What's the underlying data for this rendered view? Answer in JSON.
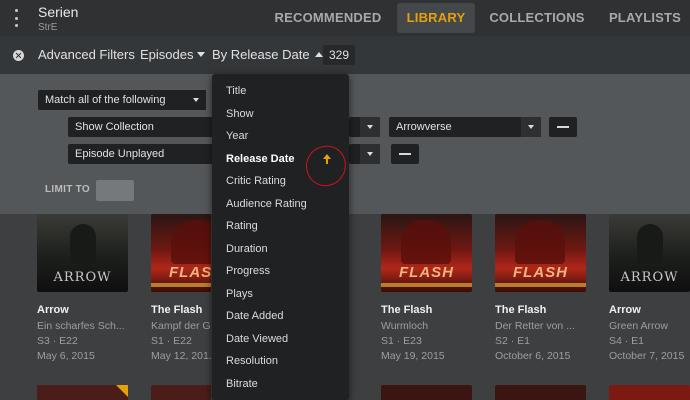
{
  "header": {
    "library_title": "Serien",
    "library_subtitle": "StrE",
    "tabs": [
      {
        "label": "RECOMMENDED"
      },
      {
        "label": "LIBRARY"
      },
      {
        "label": "COLLECTIONS"
      },
      {
        "label": "PLAYLISTS"
      }
    ],
    "active_tab": "LIBRARY",
    "accent_color": "#e5a00d"
  },
  "filter_bar": {
    "advanced_filters_label": "Advanced Filters",
    "type_label": "Episodes",
    "sort_label": "By Release Date",
    "count": "329"
  },
  "advanced_panel": {
    "match_label": "Match all of the following",
    "rules": [
      {
        "field": "Show Collection",
        "value": "Arrowverse"
      },
      {
        "field": "Episode Unplayed"
      }
    ],
    "limit_label": "LIMIT TO"
  },
  "sort_menu": {
    "items": [
      "Title",
      "Show",
      "Year",
      "Release Date",
      "Critic Rating",
      "Audience Rating",
      "Rating",
      "Duration",
      "Progress",
      "Plays",
      "Date Added",
      "Date Viewed",
      "Resolution",
      "Bitrate"
    ],
    "selected": "Release Date",
    "annotation_color": "#d3101f"
  },
  "episodes": [
    {
      "show": "Arrow",
      "episode_title": "Ein scharfes Sch...",
      "code": "S3 · E22",
      "date": "May 6, 2015",
      "poster": "arrow"
    },
    {
      "show": "The Flash",
      "episode_title": "Kampf der G...",
      "code": "S1 · E22",
      "date": "May 12, 201...",
      "poster": "flash"
    },
    {
      "show": "The Flash",
      "episode_title": "Wurmloch",
      "code": "S1 · E23",
      "date": "May 19, 2015",
      "poster": "flash"
    },
    {
      "show": "The Flash",
      "episode_title": "Der Retter von ...",
      "code": "S2 · E1",
      "date": "October 6, 2015",
      "poster": "flash"
    },
    {
      "show": "Arrow",
      "episode_title": "Green Arrow",
      "code": "S4 · E1",
      "date": "October 7, 2015",
      "poster": "arrow"
    }
  ],
  "poster_words": {
    "arrow": "ARROW",
    "flash": "FLASH"
  }
}
